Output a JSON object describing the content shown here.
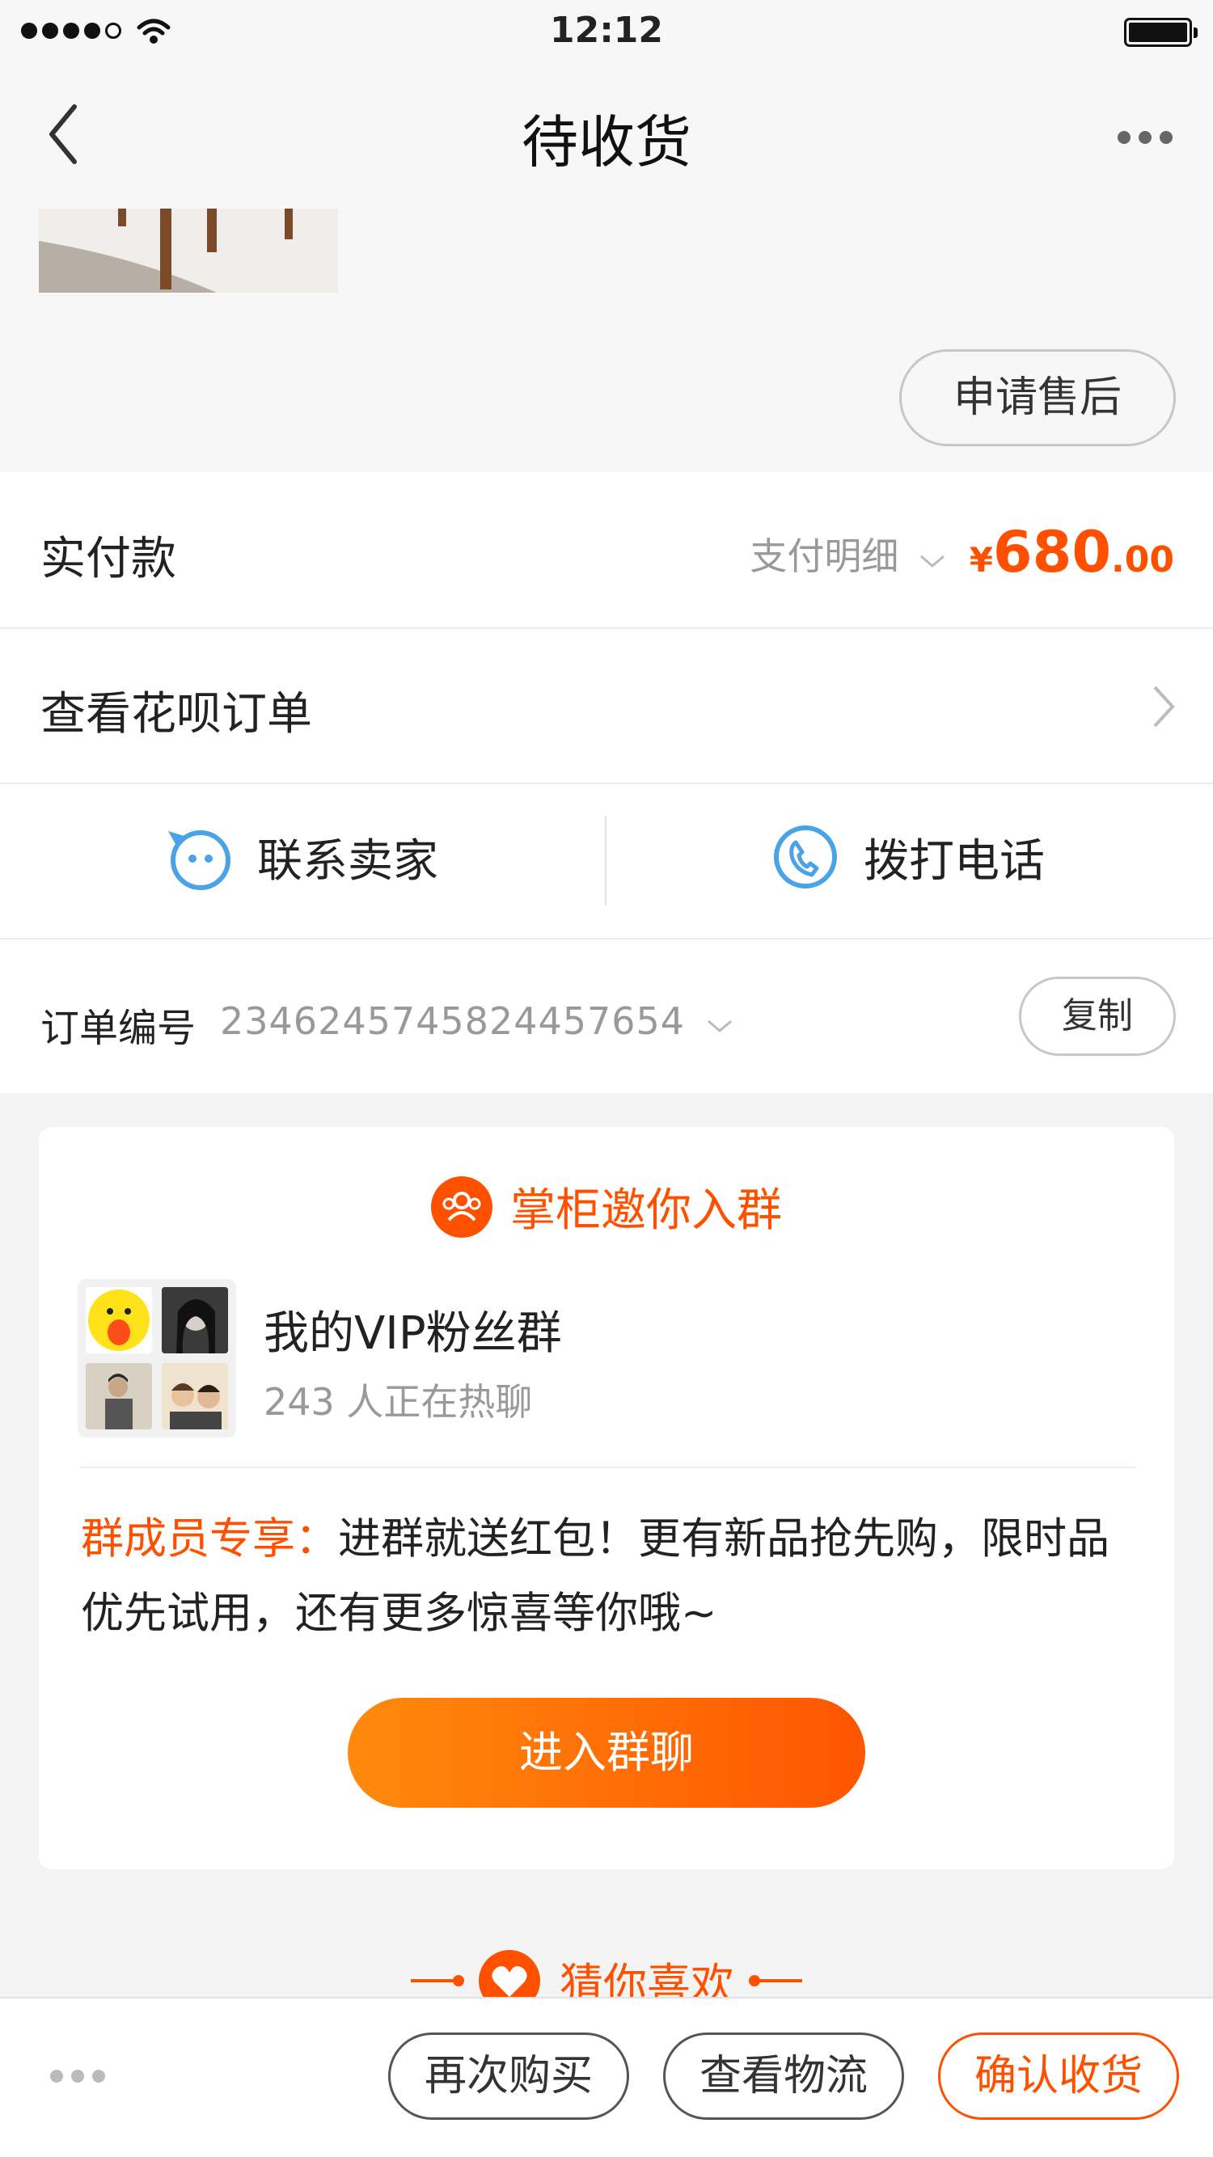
{
  "status_bar": {
    "time": "12:12"
  },
  "nav": {
    "title": "待收货"
  },
  "product": {
    "after_sale_label": "申请售后"
  },
  "payment": {
    "label": "实付款",
    "detail_label": "支付明细",
    "currency": "¥",
    "amount_int": "680",
    "amount_dec": ".00"
  },
  "huabei": {
    "label": "查看花呗订单"
  },
  "contact": {
    "seller_label": "联系卖家",
    "phone_label": "拨打电话"
  },
  "order": {
    "label": "订单编号",
    "number": "2346245745824457654",
    "copy_label": "复制"
  },
  "group": {
    "invite_title": "掌柜邀你入群",
    "name": "我的VIP粉丝群",
    "members": "243 人正在热聊",
    "perk_label": "群成员专享：",
    "perk_text": "进群就送红包！更有新品抢先购，限时品优先试用，还有更多惊喜等你哦~",
    "join_label": "进入群聊"
  },
  "recommend": {
    "title": "猜你喜欢"
  },
  "actions": {
    "buy_again": "再次购买",
    "view_logistics": "查看物流",
    "confirm_receipt": "确认收货"
  },
  "colors": {
    "accent": "#ff5000",
    "icon_blue": "#4aa3e6"
  }
}
